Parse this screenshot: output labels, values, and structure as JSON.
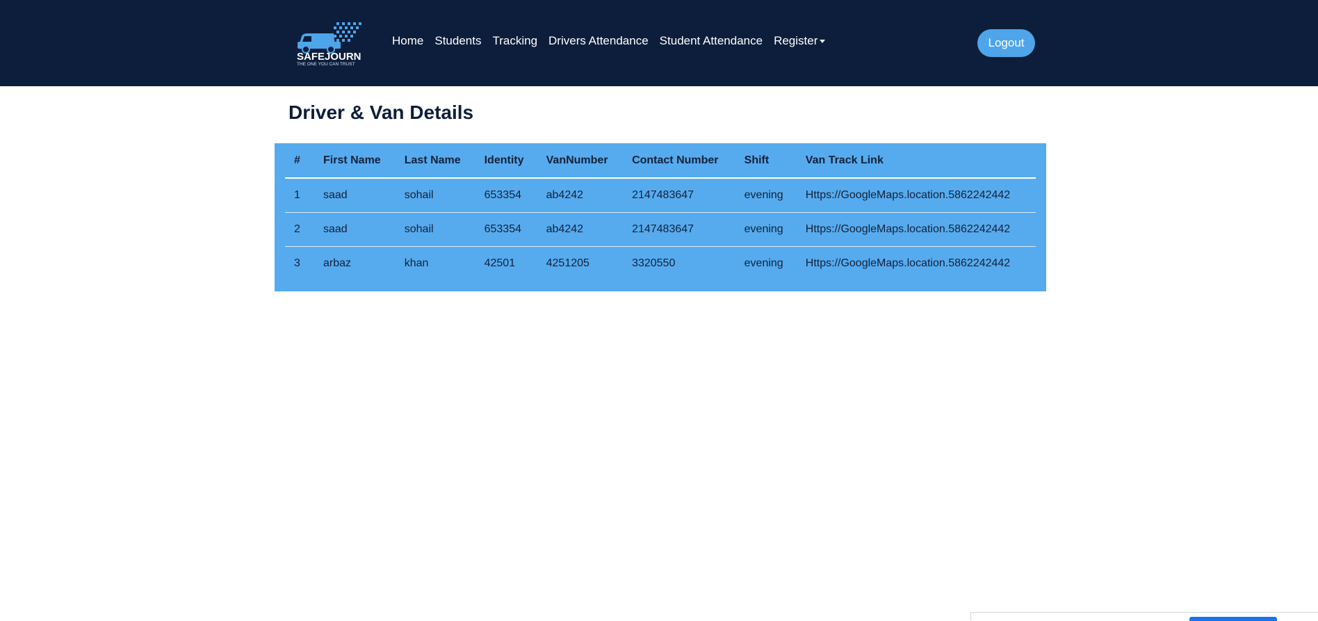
{
  "header": {
    "logo": {
      "brand": "SAFEJOURN",
      "tagline": "THE ONE YOU CAN TRUST",
      "icon": "van-icon"
    },
    "nav": [
      {
        "label": "Home"
      },
      {
        "label": "Students"
      },
      {
        "label": "Tracking"
      },
      {
        "label": "Drivers Attendance"
      },
      {
        "label": "Student Attendance"
      },
      {
        "label": "Register"
      }
    ],
    "logout_label": "Logout"
  },
  "main": {
    "title": "Driver & Van Details",
    "table": {
      "columns": [
        "#",
        "First Name",
        "Last Name",
        "Identity",
        "VanNumber",
        "Contact Number",
        "Shift",
        "Van Track Link"
      ],
      "rows": [
        [
          "1",
          "saad",
          "sohail",
          "653354",
          "ab4242",
          "2147483647",
          "evening",
          "Https://GoogleMaps.location.5862242442"
        ],
        [
          "2",
          "saad",
          "sohail",
          "653354",
          "ab4242",
          "2147483647",
          "evening",
          "Https://GoogleMaps.location.5862242442"
        ],
        [
          "3",
          "arbaz",
          "khan",
          "42501",
          "4251205",
          "3320550",
          "evening",
          "Https://GoogleMaps.location.5862242442"
        ]
      ]
    }
  },
  "colors": {
    "navbar": "#0c1e3b",
    "accent": "#4ea5e9",
    "table_bg": "#56abee"
  }
}
